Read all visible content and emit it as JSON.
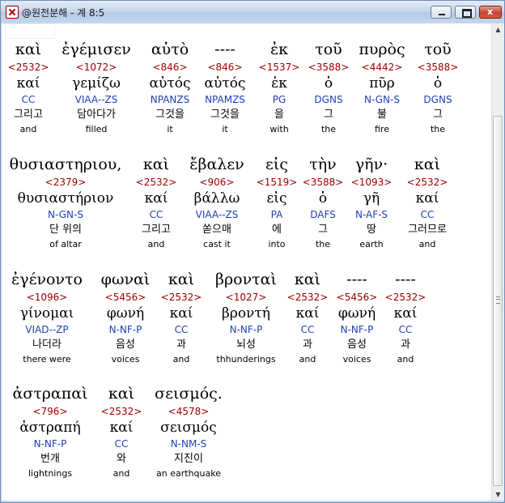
{
  "window": {
    "title": "@원전분해 - 계 8:5",
    "minimize_symbol": "",
    "maximize_symbol": "",
    "close_symbol": "x"
  },
  "scrollbar": {
    "up_arrow": "▲",
    "down_arrow": "▼",
    "position_fraction": 0.2
  },
  "rows": [
    {
      "words": [
        {
          "gk": "καὶ",
          "sn": "<2532>",
          "lm": "καί",
          "mp": "CC",
          "ko": "그리고",
          "en": "and"
        },
        {
          "gk": "ἐγέμισεν",
          "sn": "<1072>",
          "lm": "γεμίζω",
          "mp": "VIAA--ZS",
          "ko": "담아다가",
          "en": "filled"
        },
        {
          "gk": "αὐτὸ",
          "sn": "<846>",
          "lm": "αὐτός",
          "mp": "NPANZS",
          "ko": "그것을",
          "en": "it"
        },
        {
          "gk": "----",
          "sn": "<846>",
          "lm": "αὐτός",
          "mp": "NPAMZS",
          "ko": "그것을",
          "en": "it"
        },
        {
          "gk": "ἐκ",
          "sn": "<1537>",
          "lm": "ἐκ",
          "mp": "PG",
          "ko": "을",
          "en": "with"
        },
        {
          "gk": "τοῦ",
          "sn": "<3588>",
          "lm": "ὁ",
          "mp": "DGNS",
          "ko": "그",
          "en": "the"
        },
        {
          "gk": "πυρὸς",
          "sn": "<4442>",
          "lm": "πῦρ",
          "mp": "N-GN-S",
          "ko": "불",
          "en": "fire"
        },
        {
          "gk": "τοῦ",
          "sn": "<3588>",
          "lm": "ὁ",
          "mp": "DGNS",
          "ko": "그",
          "en": "the"
        }
      ]
    },
    {
      "words": [
        {
          "gk": "θυσιαστηριου,",
          "sn": "<2379>",
          "lm": "θυσιαστήριον",
          "mp": "N-GN-S",
          "ko": "단 위의",
          "en": "of altar"
        },
        {
          "gk": "καὶ",
          "sn": "<2532>",
          "lm": "καί",
          "mp": "CC",
          "ko": "그리고",
          "en": "and"
        },
        {
          "gk": "ἔβαλεν",
          "sn": "<906>",
          "lm": "βάλλω",
          "mp": "VIAA--ZS",
          "ko": "쏟으매",
          "en": "cast it"
        },
        {
          "gk": "εἰς",
          "sn": "<1519>",
          "lm": "εἰς",
          "mp": "PA",
          "ko": "에",
          "en": "into"
        },
        {
          "gk": "τὴν",
          "sn": "<3588>",
          "lm": "ὁ",
          "mp": "DAFS",
          "ko": "그",
          "en": "the"
        },
        {
          "gk": "γῆν·",
          "sn": "<1093>",
          "lm": "γῆ",
          "mp": "N-AF-S",
          "ko": "땅",
          "en": "earth"
        },
        {
          "gk": "καὶ",
          "sn": "<2532>",
          "lm": "καί",
          "mp": "CC",
          "ko": "그러므로",
          "en": "and"
        }
      ]
    },
    {
      "words": [
        {
          "gk": "ἐγένοντο",
          "sn": "<1096>",
          "lm": "γίνομαι",
          "mp": "VIAD--ZP",
          "ko": "나더라",
          "en": "there were"
        },
        {
          "gk": "φωναὶ",
          "sn": "<5456>",
          "lm": "φωνή",
          "mp": "N-NF-P",
          "ko": "음성",
          "en": "voices"
        },
        {
          "gk": "καὶ",
          "sn": "<2532>",
          "lm": "καί",
          "mp": "CC",
          "ko": "과",
          "en": "and"
        },
        {
          "gk": "βρονταὶ",
          "sn": "<1027>",
          "lm": "βροντή",
          "mp": "N-NF-P",
          "ko": "뇌성",
          "en": "thhunderings"
        },
        {
          "gk": "καὶ",
          "sn": "<2532>",
          "lm": "καί",
          "mp": "CC",
          "ko": "과",
          "en": "and"
        },
        {
          "gk": "----",
          "sn": "<5456>",
          "lm": "φωνή",
          "mp": "N-NF-P",
          "ko": "음성",
          "en": "voices"
        },
        {
          "gk": "----",
          "sn": "<2532>",
          "lm": "καί",
          "mp": "CC",
          "ko": "과",
          "en": "and"
        }
      ]
    },
    {
      "words": [
        {
          "gk": "ἀστραπαὶ",
          "sn": "<796>",
          "lm": "ἀστραπή",
          "mp": "N-NF-P",
          "ko": "번개",
          "en": "lightnings"
        },
        {
          "gk": "καὶ",
          "sn": "<2532>",
          "lm": "καί",
          "mp": "CC",
          "ko": "와",
          "en": "and"
        },
        {
          "gk": "σεισμός.",
          "sn": "<4578>",
          "lm": "σεισμός",
          "mp": "N-NM-S",
          "ko": "지진이",
          "en": "an earthquake"
        }
      ]
    }
  ]
}
